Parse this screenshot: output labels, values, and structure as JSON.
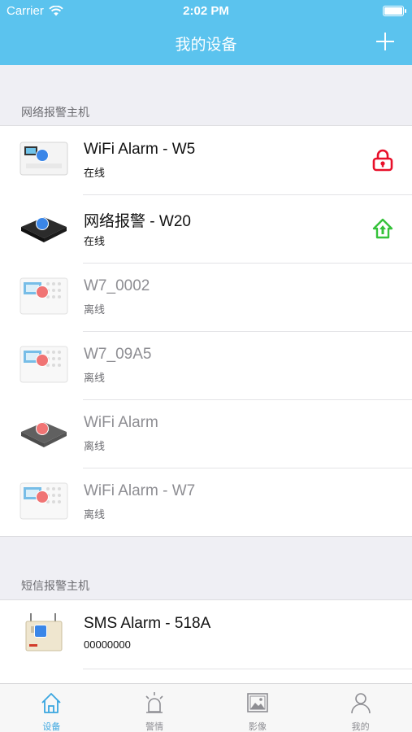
{
  "status_bar": {
    "carrier": "Carrier",
    "time": "2:02 PM"
  },
  "nav": {
    "title": "我的设备",
    "add_icon": "plus-icon"
  },
  "sections": [
    {
      "label": "网络报警主机",
      "devices": [
        {
          "name": "WiFi Alarm - W5",
          "status": "在线",
          "online": true,
          "thumb": "keypad-panel",
          "badge": "share-icon",
          "action_icon": "lock-icon",
          "action_color": "#e8102a"
        },
        {
          "name": "网络报警 - W20",
          "status": "在线",
          "online": true,
          "thumb": "black-hub",
          "badge": "share-icon",
          "action_icon": "home-arm-icon",
          "action_color": "#35c23a"
        },
        {
          "name": "W7_0002",
          "status": "离线",
          "online": false,
          "thumb": "keypad-panel",
          "badge": "fan-icon"
        },
        {
          "name": "W7_09A5",
          "status": "离线",
          "online": false,
          "thumb": "keypad-panel",
          "badge": "fan-icon"
        },
        {
          "name": "WiFi Alarm",
          "status": "离线",
          "online": false,
          "thumb": "black-hub",
          "badge": "fan-icon"
        },
        {
          "name": "WiFi Alarm - W7",
          "status": "离线",
          "online": false,
          "thumb": "keypad-panel",
          "badge": "fan-icon"
        }
      ]
    },
    {
      "label": "短信报警主机",
      "devices": [
        {
          "name": "SMS Alarm - 518A",
          "status": "00000000",
          "online": true,
          "thumb": "sms-box",
          "badge": "sms-icon"
        }
      ]
    }
  ],
  "tabs": [
    {
      "label": "设备",
      "icon": "home-icon",
      "active": true
    },
    {
      "label": "警情",
      "icon": "alarm-light-icon",
      "active": false
    },
    {
      "label": "影像",
      "icon": "image-icon",
      "active": false
    },
    {
      "label": "我的",
      "icon": "user-icon",
      "active": false
    }
  ],
  "colors": {
    "header": "#5bc3ee",
    "tab_active": "#3aa6e0",
    "lock": "#e8102a",
    "arm": "#35c23a"
  }
}
